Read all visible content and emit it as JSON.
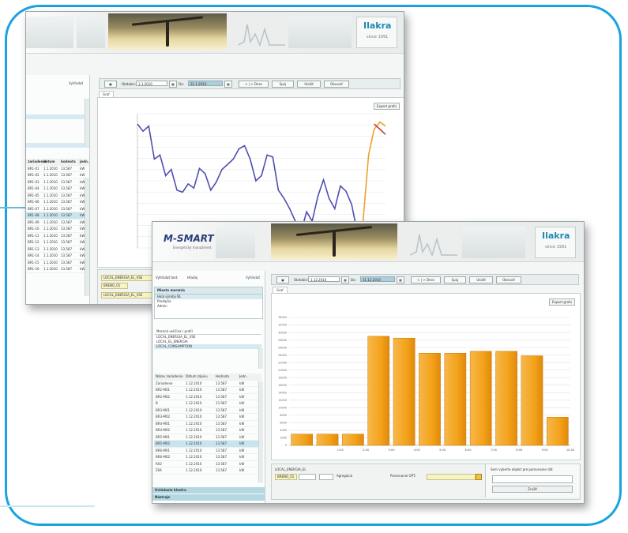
{
  "back_window": {
    "banner_logo": "Ilakra",
    "banner_logo_sub": "since 1991",
    "toolbar": {
      "from_label": "Obdobie:",
      "from_value": "1.1.2010",
      "to_label": "Do:",
      "to_value": "31.1.2010",
      "btn_nav": "< | > Dnes",
      "btn_1": "Spoj",
      "btn_2": "Uložiť",
      "btn_3": "Obnoviť"
    },
    "search_label": "Vyhľadať",
    "tab": "Graf",
    "chart_button": "Export grafu",
    "grid_header": [
      "zariadenie",
      "dátum",
      "hodnota",
      "jedn."
    ],
    "grid_rows": [
      [
        "BR1-01",
        "1.1.2010",
        "13.587",
        "kW"
      ],
      [
        "BR1-02",
        "1.1.2010",
        "13.587",
        "kW"
      ],
      [
        "BR1-03",
        "1.1.2010",
        "13.587",
        "kW"
      ],
      [
        "BR1-04",
        "1.1.2010",
        "13.587",
        "kW"
      ],
      [
        "BR1-05",
        "1.1.2010",
        "13.587",
        "kW"
      ],
      [
        "BR1-06",
        "1.1.2010",
        "13.587",
        "kW"
      ],
      [
        "BR1-07",
        "1.1.2010",
        "13.587",
        "kW"
      ],
      [
        "BR1-08",
        "1.1.2010",
        "13.587",
        "kW"
      ],
      [
        "BR1-09",
        "1.1.2010",
        "13.587",
        "kW"
      ],
      [
        "BR1-10",
        "1.1.2010",
        "13.587",
        "kW"
      ],
      [
        "BR1-11",
        "1.1.2010",
        "13.587",
        "kW"
      ],
      [
        "BR1-12",
        "1.1.2010",
        "13.587",
        "kW"
      ],
      [
        "BR1-13",
        "1.1.2010",
        "13.587",
        "kW"
      ],
      [
        "BR1-14",
        "1.1.2010",
        "13.587",
        "kW"
      ],
      [
        "BR1-15",
        "1.1.2010",
        "13.587",
        "kW"
      ],
      [
        "BR1-16",
        "1.1.2010",
        "13.587",
        "kW"
      ]
    ],
    "bottom_fields": [
      "LOCAL_ENERGIA_EL_VSE",
      "BRENO_01"
    ]
  },
  "front_window": {
    "app_title": "M-SMART",
    "app_subtitle": "Energetický manažment",
    "banner_logo": "Ilakra",
    "banner_logo_sub": "since 1991",
    "search_label": "Vyhľadať text:",
    "search_value": "Hľadaj",
    "search_button": "Vyhľadať",
    "panel1_title": "Miesto merania",
    "panel1_items": [
      "Hala výroby BL",
      "Predajňa",
      "Admin"
    ],
    "panel2_title": "Meraná veličina / profil",
    "panel2_items": [
      "LOCAL_ENERGIA_EL_VSE",
      "LOCAL_EL_ENERGIA",
      "LOCAL_CONSUMPTION"
    ],
    "grid_header": [
      "Názov zariadenia",
      "Dátum zápisu",
      "Hodnota",
      "Jedn."
    ],
    "grid_rows": [
      [
        "Zariadenie",
        "1.12.2010",
        "13.587",
        "kW"
      ],
      [
        "BR2-M01",
        "1.12.2010",
        "13.587",
        "kW"
      ],
      [
        "BR2-M02",
        "1.12.2010",
        "13.587",
        "kW"
      ],
      [
        "B",
        "1.12.2010",
        "13.587",
        "kW"
      ],
      [
        "BR3-M01",
        "1.12.2010",
        "13.587",
        "kW"
      ],
      [
        "BR3-M02",
        "1.12.2010",
        "13.587",
        "kW"
      ],
      [
        "BR4-M01",
        "1.12.2010",
        "13.587",
        "kW"
      ],
      [
        "BR4-M02",
        "1.12.2010",
        "13.587",
        "kW"
      ],
      [
        "BR5-M01",
        "1.12.2010",
        "13.587",
        "kW"
      ],
      [
        "BR5-M02",
        "1.12.2010",
        "13.587",
        "kW"
      ],
      [
        "BR6-M01",
        "1.12.2010",
        "13.587",
        "kW"
      ],
      [
        "BR6-M02",
        "1.12.2010",
        "13.587",
        "kW"
      ],
      [
        "R02",
        "1.12.2010",
        "13.587",
        "kW"
      ],
      [
        "Z04",
        "1.12.2010",
        "13.587",
        "kW"
      ]
    ],
    "bottom_panel_1": "Ovládanie klastra",
    "bottom_panel_2": "Nástroje",
    "toolbar": {
      "from_label": "Obdobie:",
      "from_value": "1.12.2010",
      "to_label": "Do:",
      "to_value": "31.12.2010",
      "btn_nav": "< | > Dnes",
      "btn_1": "Spoj",
      "btn_2": "Uložiť",
      "btn_3": "Obnoviť"
    },
    "tab": "Graf",
    "chart_button": "Export grafu",
    "bottom": {
      "field_label": "LOCAL_ENERGIA_EL",
      "field_value": "BRENO_01",
      "mid_label": "Agregácia",
      "right_label": "Porovnanie OPT:",
      "side_text": "Sem vyberte objekt pre porovnanie dát",
      "side_button": "Zrušiť"
    }
  },
  "chart_data": [
    {
      "type": "line",
      "title": "",
      "series": [
        {
          "color": "#4f4fb0",
          "values": [
            1200,
            1130,
            1180,
            860,
            900,
            700,
            760,
            560,
            540,
            620,
            580,
            770,
            720,
            560,
            640,
            760,
            810,
            860,
            960,
            990,
            860,
            650,
            700,
            900,
            880,
            560,
            480,
            380,
            260,
            150,
            350,
            260,
            500,
            660,
            480,
            380,
            600,
            550,
            420,
            150,
            130,
            120,
            0,
            0,
            0
          ]
        },
        {
          "color": "#f0a030",
          "values": [
            null,
            null,
            null,
            null,
            null,
            null,
            null,
            null,
            null,
            null,
            null,
            null,
            null,
            null,
            null,
            null,
            null,
            null,
            null,
            null,
            null,
            null,
            null,
            null,
            null,
            null,
            null,
            null,
            null,
            null,
            null,
            null,
            null,
            null,
            null,
            null,
            null,
            null,
            null,
            null,
            250,
            900,
            1150,
            1220,
            1180
          ]
        },
        {
          "color": "#c04040",
          "values": [
            null,
            null,
            null,
            null,
            null,
            null,
            null,
            null,
            null,
            null,
            null,
            null,
            null,
            null,
            null,
            null,
            null,
            null,
            null,
            null,
            null,
            null,
            null,
            null,
            null,
            null,
            null,
            null,
            null,
            null,
            null,
            null,
            null,
            null,
            null,
            null,
            null,
            null,
            null,
            null,
            null,
            null,
            1200,
            1150,
            1100
          ]
        }
      ]
    },
    {
      "type": "bar",
      "title": "",
      "categories": [
        "",
        "1:00",
        "2:00",
        "3:00",
        "4:00",
        "5:00",
        "6:00",
        "7:00",
        "8:00",
        "9:00",
        "10:00"
      ],
      "values": [
        3000,
        3000,
        3000,
        29000,
        28500,
        24500,
        24500,
        25000,
        25000,
        23800,
        7500
      ],
      "ylim": [
        0,
        34000
      ],
      "ytick_step": 2000,
      "color": "#f4a21a"
    }
  ]
}
